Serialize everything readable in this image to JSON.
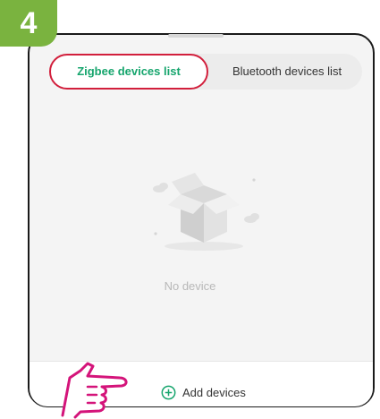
{
  "step": {
    "number": "4"
  },
  "tabs": [
    {
      "label": "Zigbee devices list",
      "active": true
    },
    {
      "label": "Bluetooth devices list",
      "active": false
    }
  ],
  "empty_state": {
    "icon": "empty-box-icon",
    "text": "No device"
  },
  "footer": {
    "add_label": "Add devices",
    "add_icon": "plus-circle-icon"
  },
  "annotation": {
    "icon": "pointing-hand-icon"
  },
  "colors": {
    "accent_green": "#16a56d",
    "highlight_red": "#d21f3c",
    "badge_green": "#7ab33f",
    "pointer_magenta": "#d4147a"
  }
}
